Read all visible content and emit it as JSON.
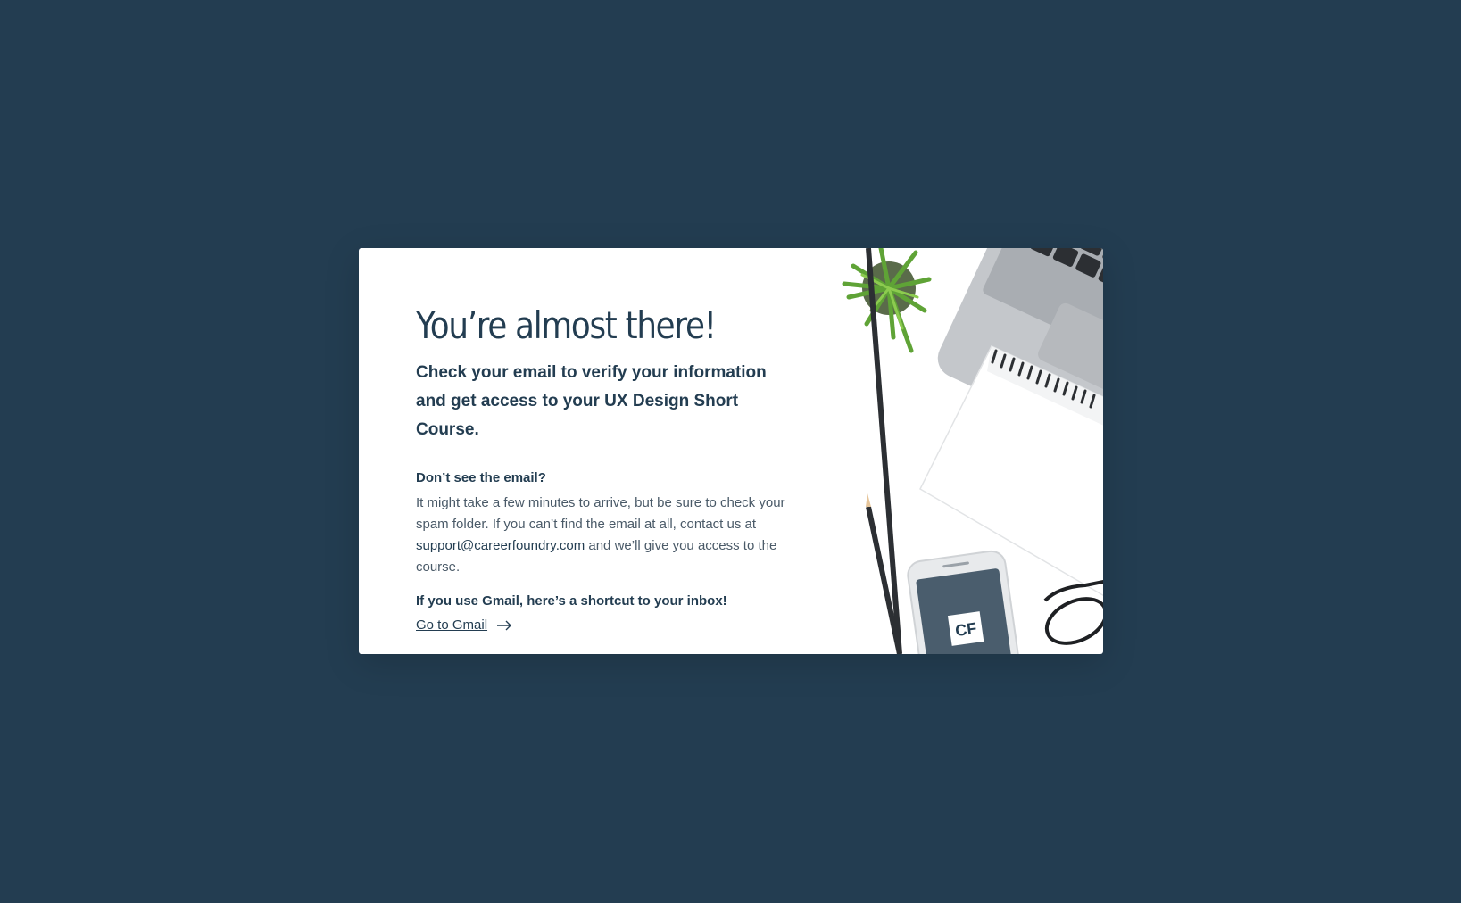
{
  "modal": {
    "title": "You’re almost there!",
    "subtitle": "Check your email to verify your information and get access to your UX Design Short Course.",
    "missing_heading": "Don’t see the email?",
    "missing_text_before": "It might take a few minutes to arrive, but be sure to check your spam folder. If you can’t find the email at all, contact us at ",
    "support_email": "support@careerfoundry.com",
    "missing_text_after": " and we’ll give you access to the course.",
    "gmail_heading": "If you use Gmail, here’s a shortcut to your inbox!",
    "gmail_link": "Go to Gmail",
    "logo_text": "CF"
  },
  "colors": {
    "background": "#233d51",
    "card": "#ffffff",
    "text": "#233d51"
  }
}
